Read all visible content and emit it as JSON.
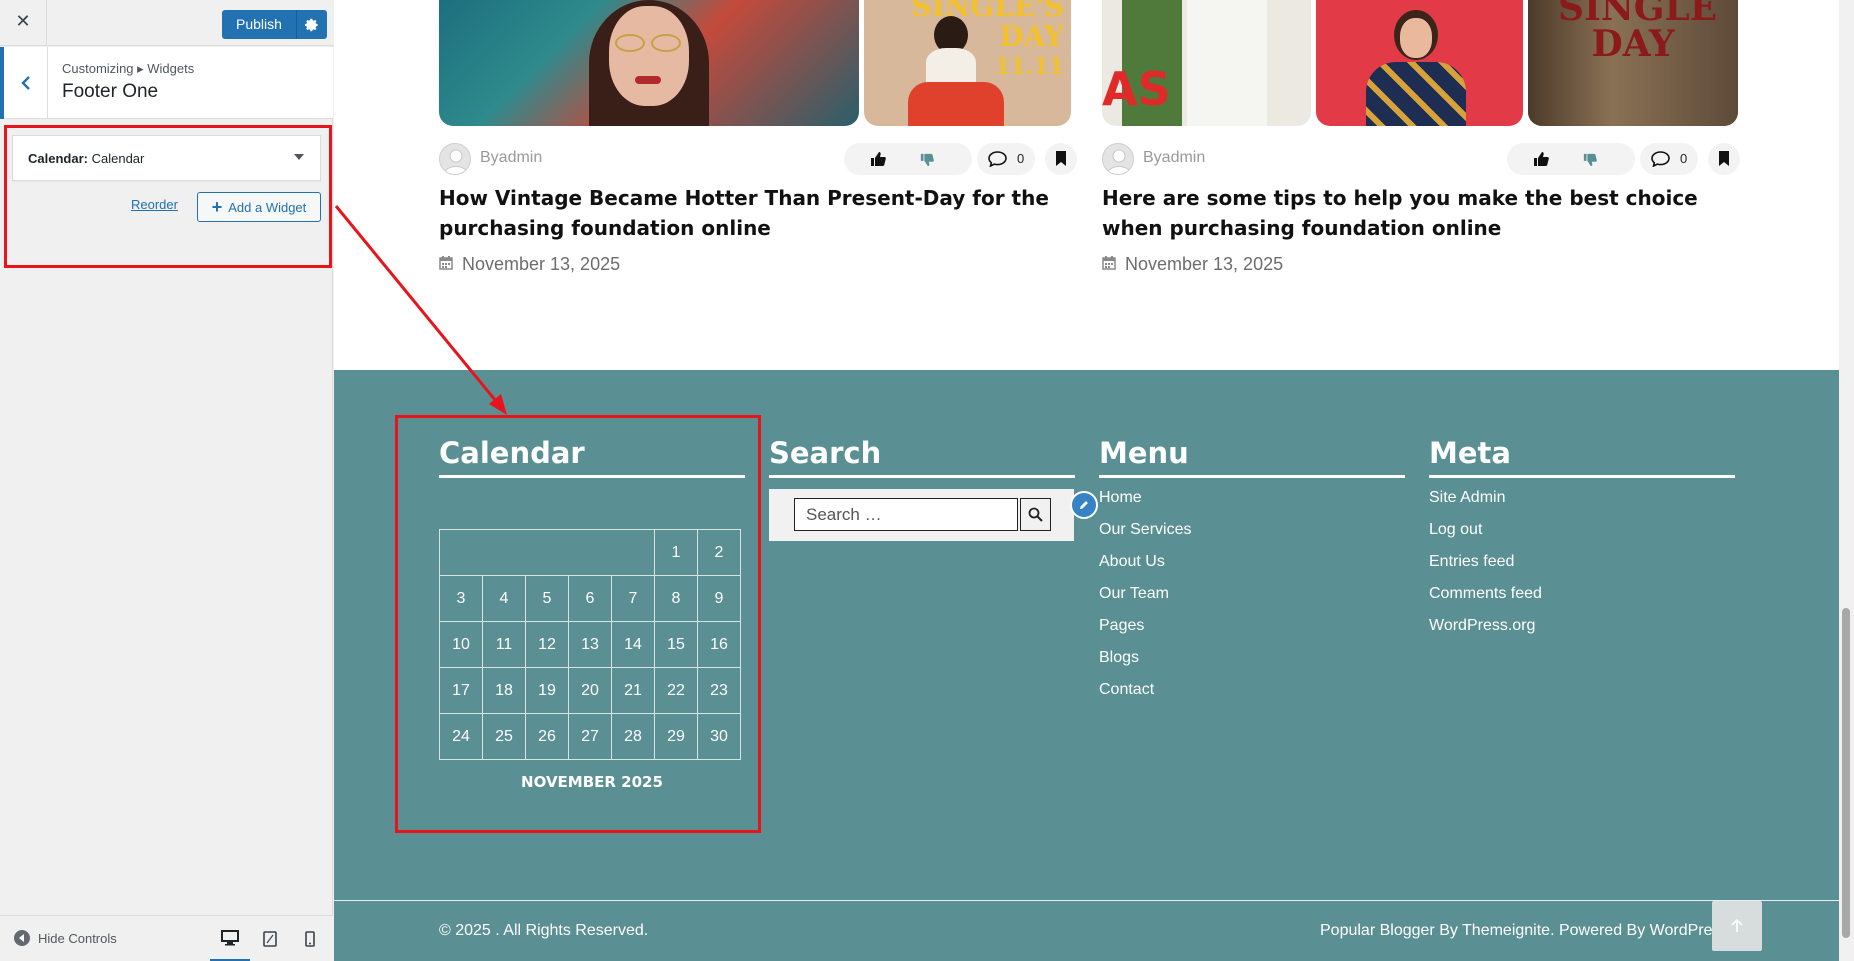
{
  "customizer": {
    "publish_label": "Publish",
    "breadcrumb": "Customizing ▸ Widgets",
    "section_title": "Footer One",
    "widget": {
      "type_label": "Calendar",
      "separator": ":",
      "title_label": "Calendar"
    },
    "reorder_label": "Reorder",
    "add_widget_label": "Add a Widget",
    "hide_controls_label": "Hide Controls",
    "accent_color": "#2271b1"
  },
  "posts": [
    {
      "author": "Byadmin",
      "comments": "0",
      "title": "How Vintage Became Hotter Than Present-Day for the purchasing foundation online",
      "date": "November 13, 2025",
      "image_text": [
        "SINGLE'S",
        "DAY",
        "11.11"
      ]
    },
    {
      "author": "Byadmin",
      "comments": "0",
      "title": "Here are some tips to help you make the best choice when purchasing foundation online",
      "date": "November 13, 2025",
      "image_text": [
        "AS",
        "SINGLE",
        "DAY"
      ]
    }
  ],
  "footer": {
    "background": "#5a8f93",
    "calendar": {
      "title": "Calendar",
      "rows": [
        [
          "",
          "",
          "",
          "",
          "",
          "1",
          "2"
        ],
        [
          "3",
          "4",
          "5",
          "6",
          "7",
          "8",
          "9"
        ],
        [
          "10",
          "11",
          "12",
          "13",
          "14",
          "15",
          "16"
        ],
        [
          "17",
          "18",
          "19",
          "20",
          "21",
          "22",
          "23"
        ],
        [
          "24",
          "25",
          "26",
          "27",
          "28",
          "29",
          "30"
        ]
      ],
      "caption": "NOVEMBER 2025"
    },
    "search": {
      "title": "Search",
      "placeholder": "Search …"
    },
    "menu": {
      "title": "Menu",
      "items": [
        "Home",
        "Our Services",
        "About Us",
        "Our Team",
        "Pages",
        "Blogs",
        "Contact"
      ]
    },
    "meta": {
      "title": "Meta",
      "items": [
        "Site Admin",
        "Log out",
        "Entries feed",
        "Comments feed",
        "WordPress.org"
      ]
    },
    "copyright": "© 2025 . All Rights Reserved.",
    "credits": "Popular Blogger By Themeignite. Powered By WordPress."
  },
  "annotation_color": "#e8141c"
}
